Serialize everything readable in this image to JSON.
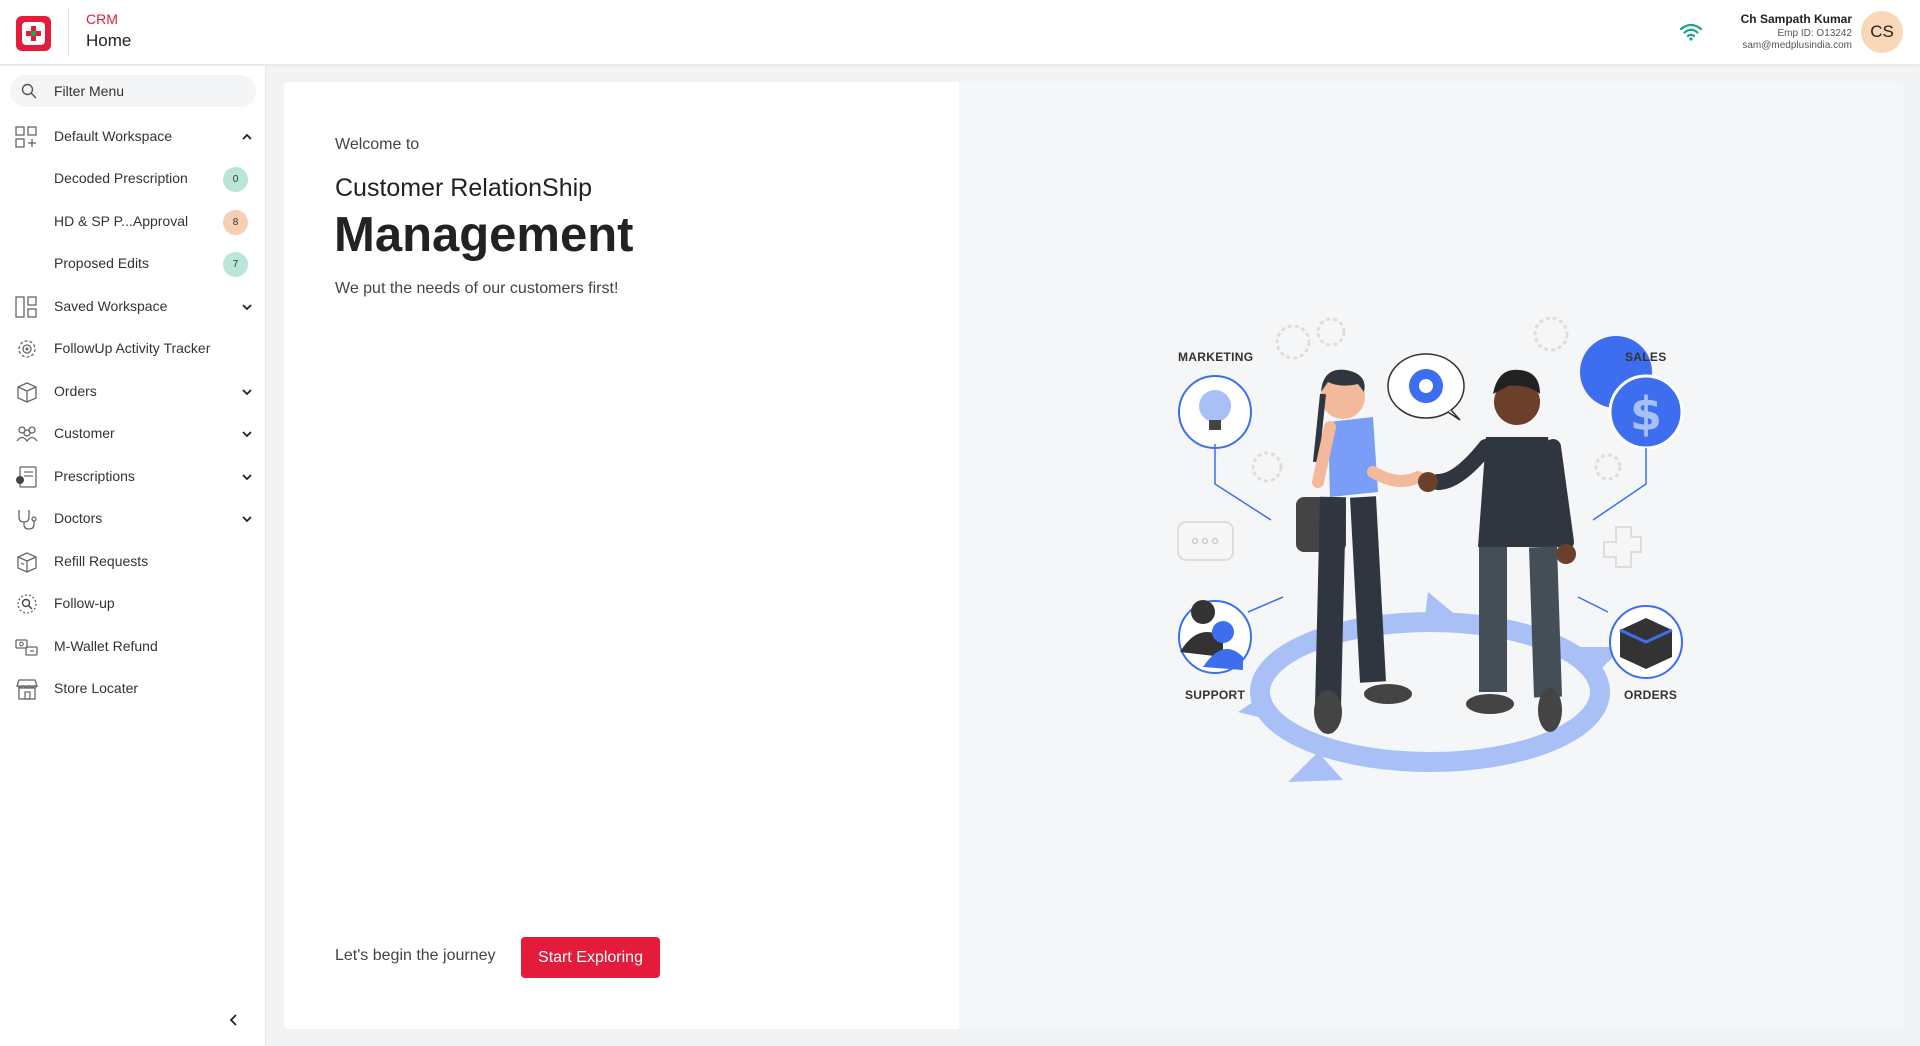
{
  "header": {
    "app_name": "CRM",
    "page_name": "Home",
    "user": {
      "name": "Ch Sampath Kumar",
      "emp_id": "Emp ID: O13242",
      "email": "sam@medplusindia.com",
      "initials": "CS"
    }
  },
  "sidebar": {
    "filter_placeholder": "Filter Menu",
    "default_workspace": {
      "label": "Default Workspace",
      "items": [
        {
          "label": "Decoded Prescription",
          "count": "0",
          "badge_color": "#b9e6d8"
        },
        {
          "label": "HD & SP P...Approval",
          "count": "8",
          "badge_color": "#f7cdb3"
        },
        {
          "label": "Proposed Edits",
          "count": "7",
          "badge_color": "#b9e6d8"
        }
      ]
    },
    "items": [
      {
        "label": "Saved Workspace"
      },
      {
        "label": "FollowUp Activity Tracker"
      },
      {
        "label": "Orders"
      },
      {
        "label": "Customer"
      },
      {
        "label": "Prescriptions"
      },
      {
        "label": "Doctors"
      },
      {
        "label": "Refill Requests"
      },
      {
        "label": "Follow-up"
      },
      {
        "label": "M-Wallet Refund"
      },
      {
        "label": "Store Locater"
      }
    ]
  },
  "main": {
    "welcome": "Welcome to",
    "title_line1": "Customer RelationShip",
    "title_line2": "Management",
    "tagline": "We put the needs of our customers first!",
    "journey_text": "Let's begin the journey",
    "cta_label": "Start Exploring",
    "illustration_labels": {
      "marketing": "MARKETING",
      "sales": "SALES",
      "support": "SUPPORT",
      "orders": "ORDERS"
    }
  },
  "colors": {
    "brand_red": "#e41b3b",
    "accent_blue": "#3d6ef0",
    "wifi_green": "#1aa58a",
    "avatar_bg": "#f9d7b8"
  }
}
